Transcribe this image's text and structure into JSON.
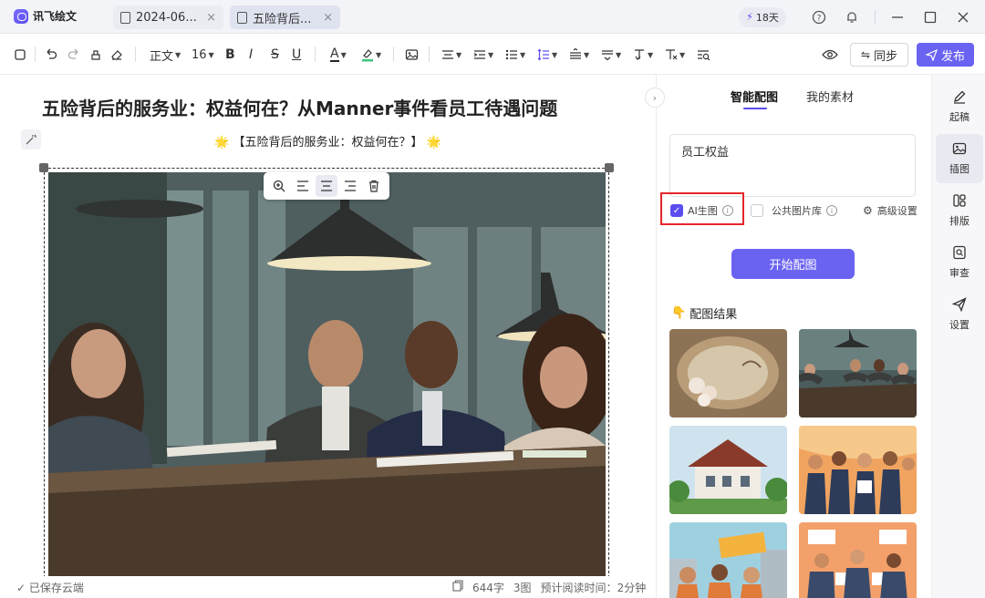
{
  "app": {
    "name": "讯飞绘文"
  },
  "tabs": [
    {
      "label": "2024-06...",
      "close": "×"
    },
    {
      "label": "五险背后...",
      "close": "×"
    }
  ],
  "titlebar": {
    "days_left": "18天"
  },
  "toolbar": {
    "style_select": "正文",
    "font_size": "16",
    "bold": "B",
    "italic": "I",
    "strike": "S",
    "underline": "U",
    "font_color": "A",
    "sync_label": "同步",
    "publish_label": "发布"
  },
  "editor": {
    "title": "五险背后的服务业：权益何在？从Manner事件看员工待遇问题",
    "subtitle": "【五险背后的服务业：权益何在？】",
    "subtitle_emoji": "🌟"
  },
  "status": {
    "saved": "已保存云端",
    "word_count": "644字",
    "image_count": "3图",
    "read_time_label": "预计阅读时间：",
    "read_time": "2分钟"
  },
  "panel": {
    "tabs": [
      "智能配图",
      "我的素材"
    ],
    "keyword": "员工权益",
    "options": {
      "ai_image": "AI生图",
      "public_library": "公共图片库",
      "advanced": "高级设置"
    },
    "start_button": "开始配图",
    "results_title": "配图结果"
  },
  "rail": [
    {
      "label": "起稿",
      "icon": "pen-icon"
    },
    {
      "label": "插图",
      "icon": "image-icon"
    },
    {
      "label": "排版",
      "icon": "layout-icon"
    },
    {
      "label": "审查",
      "icon": "review-icon"
    },
    {
      "label": "设置",
      "icon": "send-icon"
    }
  ],
  "colors": {
    "accent": "#6a63f1",
    "highlight_box": "#e6262b"
  }
}
